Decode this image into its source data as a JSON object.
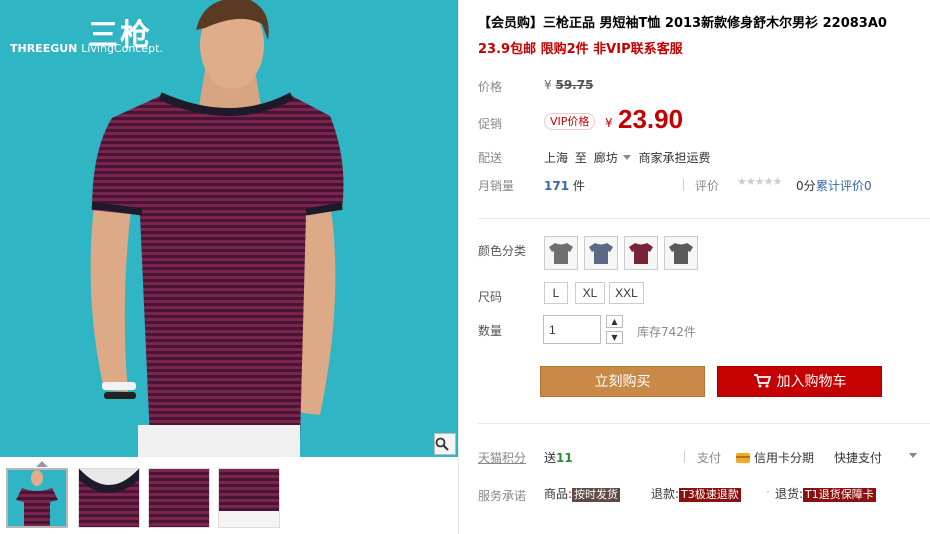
{
  "brand": {
    "cn": "三枪",
    "en_bold": "THREEGUN",
    "en_light": "LivingConcept."
  },
  "gallery": {
    "zoom_icon": "magnifier-icon",
    "thumbnail_count": 4
  },
  "product": {
    "title": "【会员购】三枪正品 男短袖T恤 2013新款修身舒木尔男衫 22083A0",
    "subtitle": "23.9包邮 限购2件 非VIP联系客服"
  },
  "price": {
    "label": "价格",
    "currency": "¥",
    "original": "59.75"
  },
  "promo": {
    "label": "促销",
    "vip_tag": "VIP价格",
    "currency": "¥",
    "price": "23.90"
  },
  "shipping": {
    "label": "配送",
    "from": "上海",
    "to_word": "至",
    "to": "廊坊",
    "fee_note": "商家承担运费"
  },
  "sales": {
    "label": "月销量",
    "count": "171",
    "unit": "件",
    "rating_label": "评价",
    "score": "0分",
    "review_label": "累计评价",
    "review_count": "0"
  },
  "options": {
    "color_label": "颜色分类",
    "colors": [
      "#6f6f6f",
      "#5a6a86",
      "#7a2438",
      "#5a5a5a"
    ],
    "size_label": "尺码",
    "sizes": [
      "L",
      "XL",
      "XXL"
    ],
    "qty_label": "数量",
    "qty_value": "1",
    "stock": "库存742件"
  },
  "actions": {
    "buy_now": "立刻购买",
    "add_cart": "加入购物车"
  },
  "points": {
    "label": "天猫积分",
    "send": "送",
    "amount": "11",
    "pay_label": "支付",
    "credit": "信用卡分期",
    "quick_pay": "快捷支付"
  },
  "service": {
    "label": "服务承诺",
    "goods_label": "商品:",
    "goods_tag": "按时发货",
    "refund_label": "退款:",
    "refund_tag": "T3极速退款",
    "return_label": "退货:",
    "return_tag": "T1退货保障卡"
  },
  "colors": {
    "accent_red": "#c40000",
    "buy_button": "#c98a47",
    "bg_cyan": "#2fb5c4",
    "shirt": "#5a1a3c"
  }
}
